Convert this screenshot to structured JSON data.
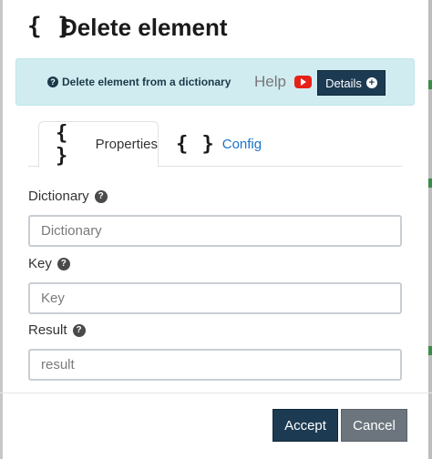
{
  "dialog": {
    "title_icon": "{ }",
    "title": "Delete element"
  },
  "help": {
    "description_icon": "question-circle-icon",
    "description": "Delete element from a dictionary",
    "help_label": "Help",
    "video_icon": "youtube-icon",
    "details_label": "Details",
    "details_icon": "plus-circle-icon"
  },
  "tabs": [
    {
      "icon": "{ }",
      "label": "Properties",
      "active": true
    },
    {
      "icon": "{ }",
      "label": "Config",
      "active": false
    }
  ],
  "fields": [
    {
      "label": "Dictionary",
      "placeholder": "Dictionary",
      "value": ""
    },
    {
      "label": "Key",
      "placeholder": "Key",
      "value": ""
    },
    {
      "label": "Result",
      "placeholder": "result",
      "value": ""
    }
  ],
  "footer": {
    "accept_label": "Accept",
    "cancel_label": "Cancel"
  },
  "colors": {
    "primary": "#1c3b53",
    "secondary": "#6c757d",
    "info_bg": "#d1ecf1",
    "link": "#1a73c8",
    "youtube": "#e62117"
  }
}
